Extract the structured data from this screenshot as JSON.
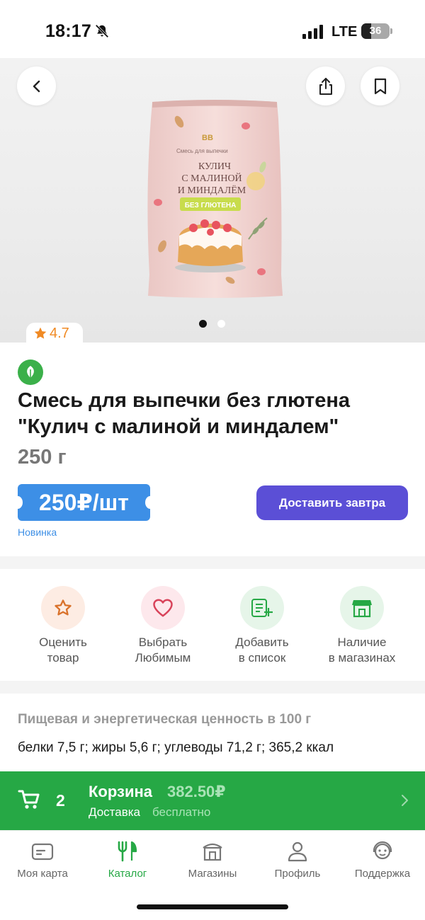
{
  "status": {
    "time": "18:17",
    "network": "LTE",
    "battery": "36",
    "battery_level": 0.36,
    "icons": [
      "bell-slash-icon",
      "signal-icon",
      "battery-icon"
    ]
  },
  "product": {
    "rating": "4.7",
    "title_line1": "Смесь для выпечки без глютена",
    "title_line2": "\"Кулич с малиной и миндалем\"",
    "weight": "250 г",
    "price": "250₽/шт",
    "badge": "Новинка",
    "deliver_label": "Доставить завтра",
    "image_slides": 2,
    "active_slide": 1,
    "package": {
      "brand": "ВВ",
      "subtitle": "Смесь для выпечки",
      "name_line1": "КУЛИЧ",
      "name_line2": "С МАЛИНОЙ",
      "name_line3": "И МИНДАЛЁМ",
      "tag": "БЕЗ ГЛЮТЕНА"
    }
  },
  "actions": [
    {
      "line1": "Оценить",
      "line2": "товар",
      "icon": "star-icon"
    },
    {
      "line1": "Выбрать",
      "line2": "Любимым",
      "icon": "heart-icon"
    },
    {
      "line1": "Добавить",
      "line2": "в список",
      "icon": "list-add-icon"
    },
    {
      "line1": "Наличие",
      "line2": "в магазинах",
      "icon": "store-icon"
    }
  ],
  "nutrition": {
    "title": "Пищевая и энергетическая ценность в 100 г",
    "value": "белки 7,5 г; жиры 5,6 г; углеводы 71,2 г; 365,2 ккал"
  },
  "cart": {
    "count": "2",
    "title": "Корзина",
    "sum": "382.50₽",
    "delivery_label": "Доставка",
    "delivery_value": "бесплатно"
  },
  "tabs": [
    {
      "label": "Моя карта",
      "icon": "card-icon"
    },
    {
      "label": "Каталог",
      "icon": "fork-knife-icon"
    },
    {
      "label": "Магазины",
      "icon": "shop-icon"
    },
    {
      "label": "Профиль",
      "icon": "profile-icon"
    },
    {
      "label": "Поддержка",
      "icon": "support-icon"
    }
  ],
  "active_tab": "Каталог",
  "colors": {
    "brand_green": "#26a845",
    "price_blue": "#3d8fe6",
    "deliver_purple": "#5b4fd6",
    "rating_orange": "#f08a24"
  }
}
